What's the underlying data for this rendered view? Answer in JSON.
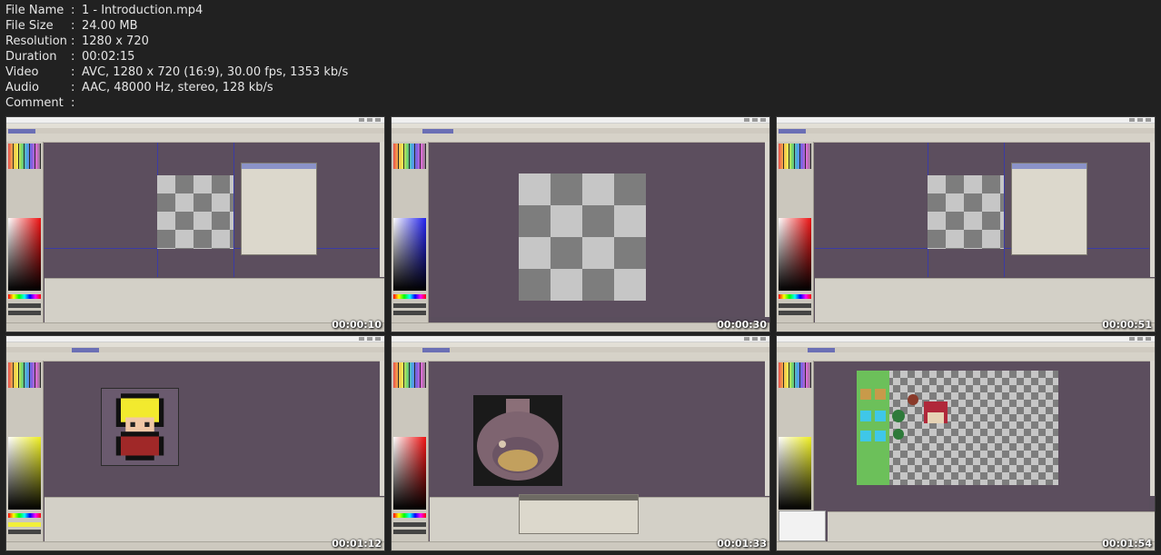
{
  "file_info": [
    {
      "key": "File Name",
      "value": "1 - Introduction.mp4"
    },
    {
      "key": "File Size",
      "value": "24.00 MB"
    },
    {
      "key": "Resolution",
      "value": "1280 x 720"
    },
    {
      "key": "Duration",
      "value": "00:02:15"
    },
    {
      "key": "Video",
      "value": "AVC, 1280 x 720 (16:9), 30.00 fps, 1353 kb/s"
    },
    {
      "key": "Audio",
      "value": "AAC, 48000 Hz, stereo, 128 kb/s"
    },
    {
      "key": "Comment",
      "value": ""
    }
  ],
  "separator": ":",
  "thumbnails": [
    {
      "timestamp": "00:00:10",
      "scene": "canvas-size-dialog"
    },
    {
      "timestamp": "00:00:30",
      "scene": "blank-checker-canvas"
    },
    {
      "timestamp": "00:00:51",
      "scene": "canvas-size-dialog"
    },
    {
      "timestamp": "00:01:12",
      "scene": "character-sprite"
    },
    {
      "timestamp": "00:01:33",
      "scene": "stone-well-tile"
    },
    {
      "timestamp": "00:01:54",
      "scene": "tileset-sheet"
    }
  ],
  "colors": {
    "background": "#212121",
    "app_canvas": "#5c4e5e",
    "app_chrome": "#d3d0c7",
    "timestamp": "#ffffff"
  }
}
